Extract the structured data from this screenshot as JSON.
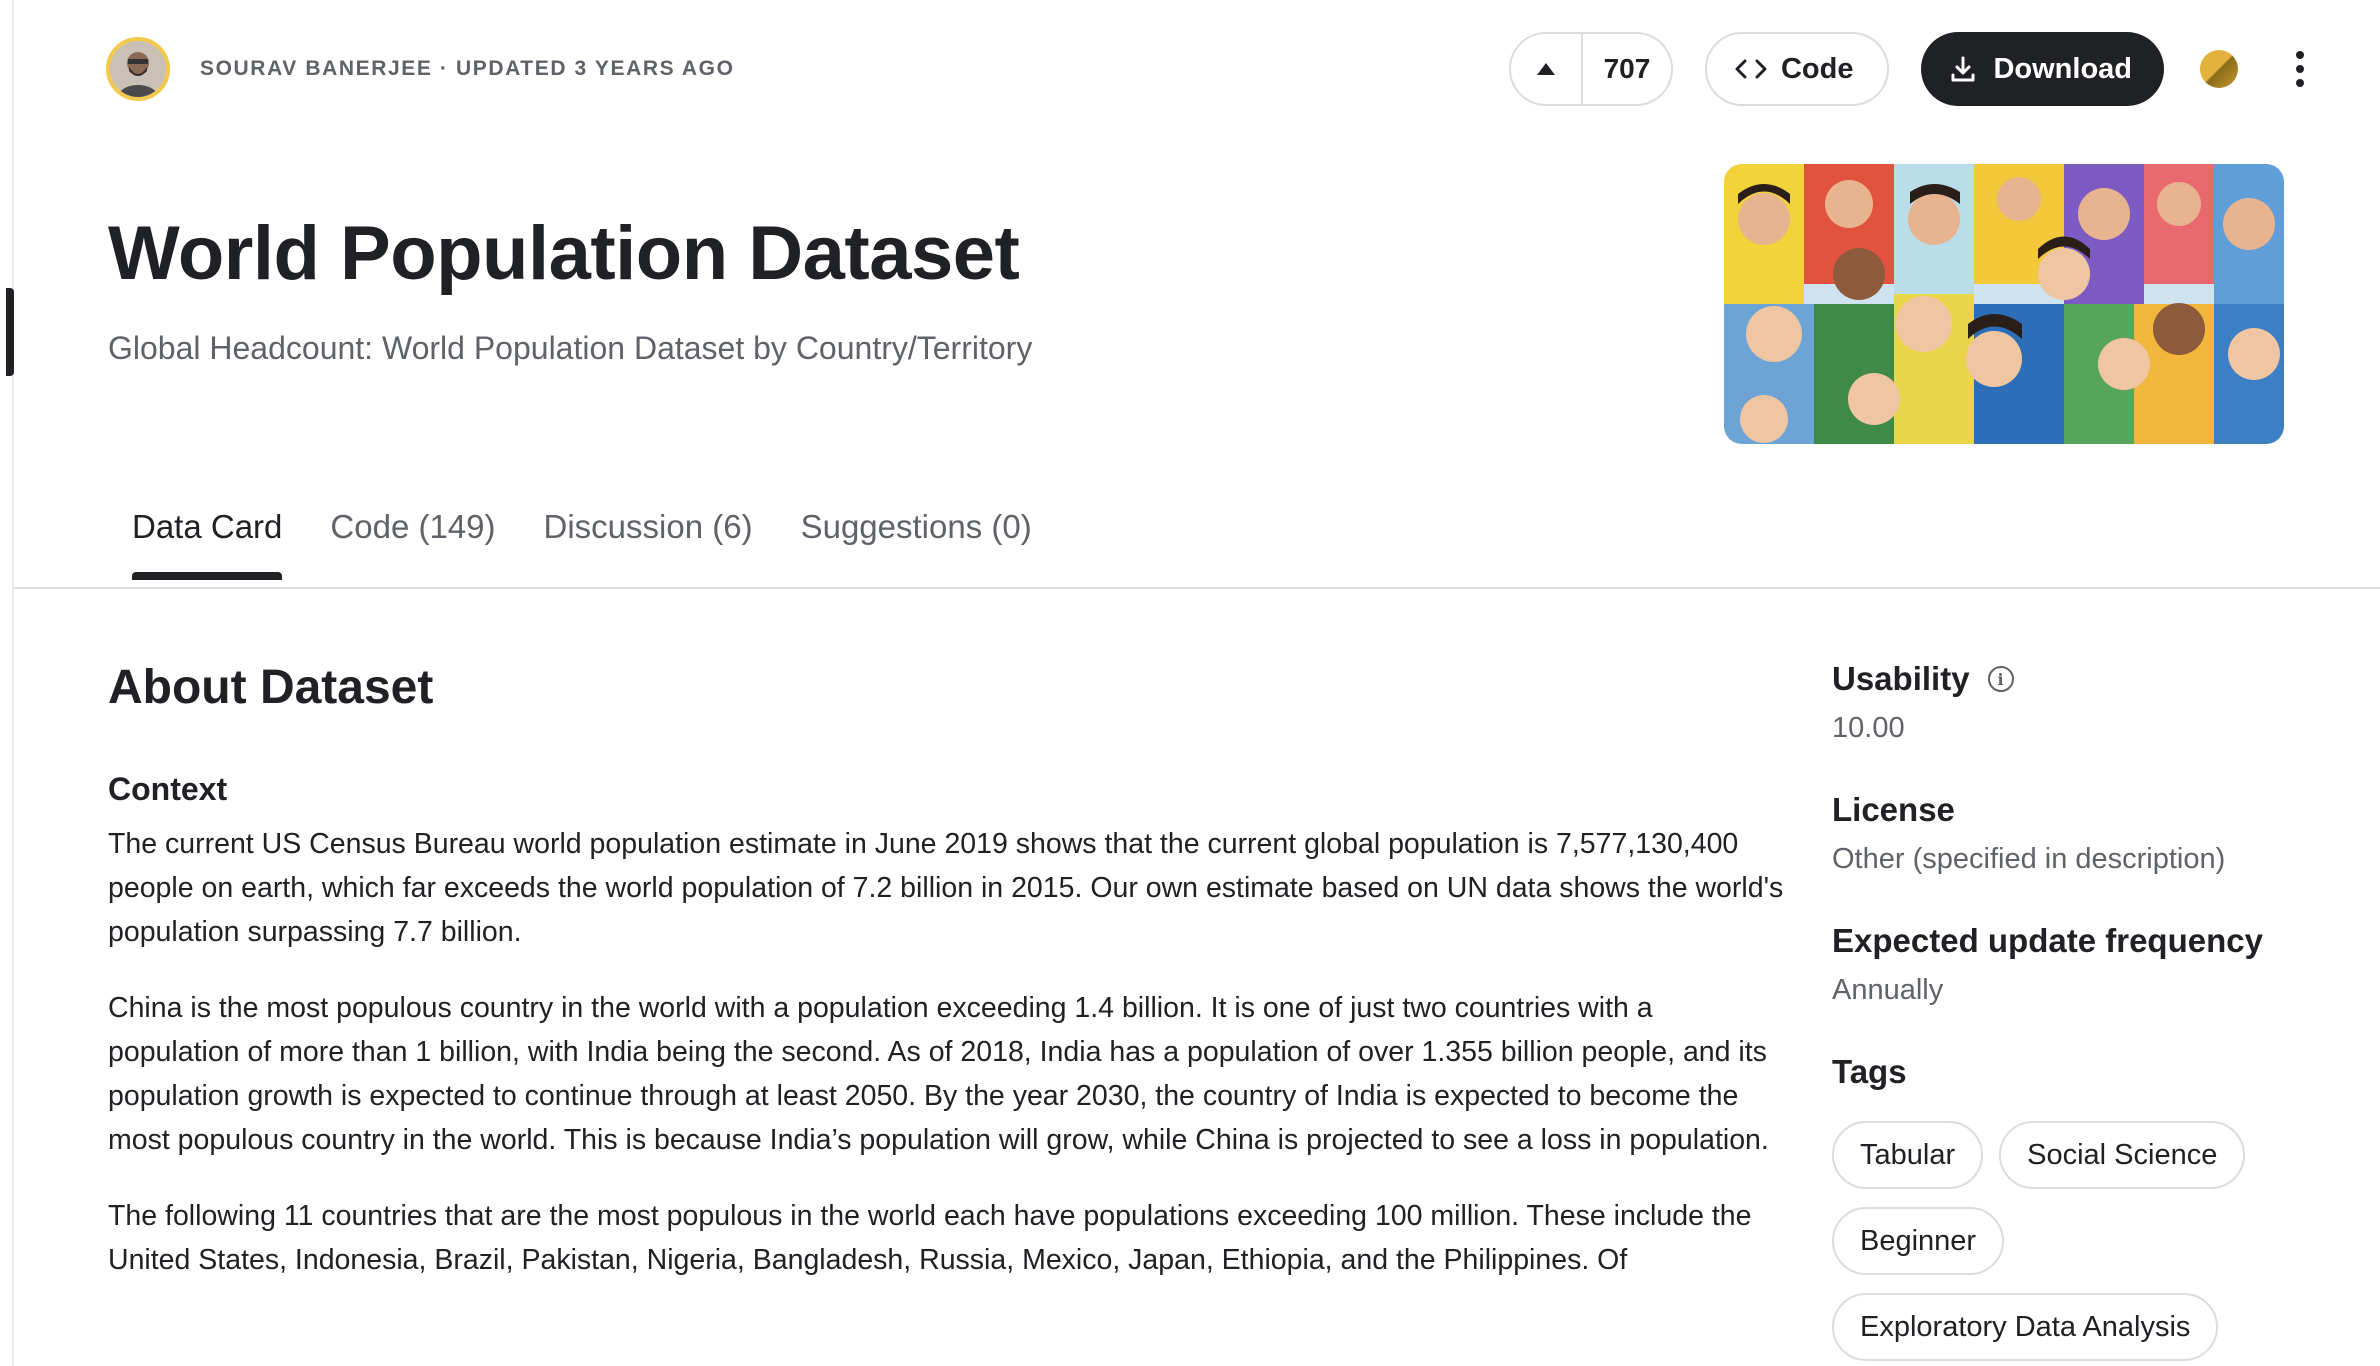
{
  "header": {
    "author_meta": "SOURAV BANERJEE · UPDATED 3 YEARS AGO",
    "vote_count": "707",
    "code_label": "Code",
    "download_label": "Download"
  },
  "dataset": {
    "title": "World Population Dataset",
    "subtitle": "Global Headcount: World Population Dataset by Country/Territory"
  },
  "tabs": [
    {
      "label": "Data Card"
    },
    {
      "label": "Code (149)"
    },
    {
      "label": "Discussion (6)"
    },
    {
      "label": "Suggestions (0)"
    }
  ],
  "about": {
    "heading": "About Dataset",
    "context_heading": "Context",
    "paragraphs": [
      "The current US Census Bureau world population estimate in June 2019 shows that the current global population is 7,577,130,400 people on earth, which far exceeds the world population of 7.2 billion in 2015. Our own estimate based on UN data shows the world's population surpassing 7.7 billion.",
      "China is the most populous country in the world with a population exceeding 1.4 billion. It is one of just two countries with a population of more than 1 billion, with India being the second. As of 2018, India has a population of over 1.355 billion people, and its population growth is expected to continue through at least 2050. By the year 2030, the country of India is expected to become the most populous country in the world. This is because India’s population will grow, while China is projected to see a loss in population.",
      "The following 11 countries that are the most populous in the world each have populations exceeding 100 million. These include the United States, Indonesia, Brazil, Pakistan, Nigeria, Bangladesh, Russia, Mexico, Japan, Ethiopia, and the Philippines. Of"
    ]
  },
  "sidebar": {
    "usability_label": "Usability",
    "usability_value": "10.00",
    "license_label": "License",
    "license_value": "Other (specified in description)",
    "frequency_label": "Expected update frequency",
    "frequency_value": "Annually",
    "tags_label": "Tags",
    "tags": [
      "Tabular",
      "Social Science",
      "Beginner",
      "Exploratory Data Analysis"
    ]
  },
  "colors": {
    "accent_dark": "#202124",
    "muted_text": "#5f6368",
    "border": "#dadce0",
    "avatar_ring": "#f2c94c"
  }
}
